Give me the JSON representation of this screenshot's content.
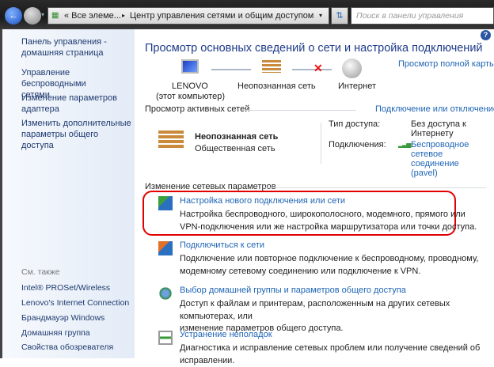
{
  "address": {
    "prefix": "« Все элеме...",
    "separator": "▸",
    "current": "Центр управления сетями и общим доступом"
  },
  "search": {
    "placeholder": "Поиск в панели управления"
  },
  "help": "?",
  "sidebar": {
    "links": [
      "Панель управления -\nдомашняя страница",
      "Управление беспроводными\nсетями",
      "Изменение параметров\nадаптера",
      "Изменить дополнительные\nпараметры общего доступа"
    ],
    "see_also_title": "См. также",
    "see_also": [
      "Intel® PROSet/Wireless",
      "Lenovo's Internet Connection",
      "Брандмауэр Windows",
      "Домашняя группа",
      "Свойства обозревателя"
    ]
  },
  "main": {
    "title": "Просмотр основных сведений о сети и настройка подключений",
    "full_map": "Просмотр полной карты",
    "map": {
      "computer": "LENOVO",
      "computer_sub": "(этот компьютер)",
      "network": "Неопознанная сеть",
      "internet": "Интернет"
    },
    "active_title": "Просмотр активных сетей",
    "connect_disconnect": "Подключение или отключение",
    "net_name": "Неопознанная сеть",
    "net_type": "Общественная сеть",
    "access_label": "Тип доступа:",
    "access_value": "Без доступа к\nИнтернету",
    "conn_label": "Подключения:",
    "conn_value": "Беспроводное\nсетевое соединение\n(pavel)",
    "change_title": "Изменение сетевых параметров",
    "tasks": [
      {
        "link": "Настройка нового подключения или сети",
        "desc": "Настройка беспроводного, широкополосного, модемного, прямого или\nVPN-подключения или же настройка маршрутизатора или точки доступа."
      },
      {
        "link": "Подключиться к сети",
        "desc": "Подключение или повторное подключение к беспроводному, проводному,\nмодемному сетевому соединению или подключение к VPN."
      },
      {
        "link": "Выбор домашней группы и параметров общего доступа",
        "desc": "Доступ к файлам и принтерам, расположенным на других сетевых компьютерах, или\nизменение параметров общего доступа."
      },
      {
        "link": "Устранение неполадок",
        "desc": "Диагностика и исправление сетевых проблем или получение сведений об\nисправлении."
      }
    ]
  }
}
